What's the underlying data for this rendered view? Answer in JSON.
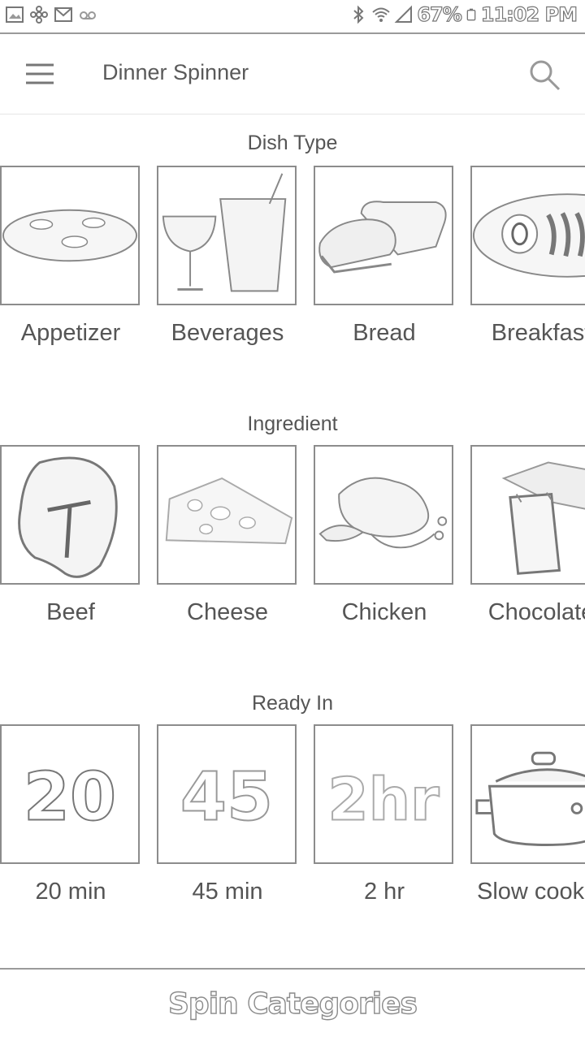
{
  "status_bar": {
    "battery": "67%",
    "time": "11:02 PM"
  },
  "app_bar": {
    "title": "Dinner Spinner"
  },
  "sections": [
    {
      "title": "Dish Type",
      "items": [
        "Appetizer",
        "Beverages",
        "Bread",
        "Breakfast"
      ]
    },
    {
      "title": "Ingredient",
      "items": [
        "Beef",
        "Cheese",
        "Chicken",
        "Chocolate"
      ]
    },
    {
      "title": "Ready In",
      "items": [
        "20 min",
        "45 min",
        "2 hr",
        "Slow cooker"
      ]
    }
  ],
  "tile_texts": {
    "min20": "20",
    "min45": "45",
    "hr2": "2hr"
  },
  "bottom_bar": {
    "label": "Spin Categories"
  }
}
